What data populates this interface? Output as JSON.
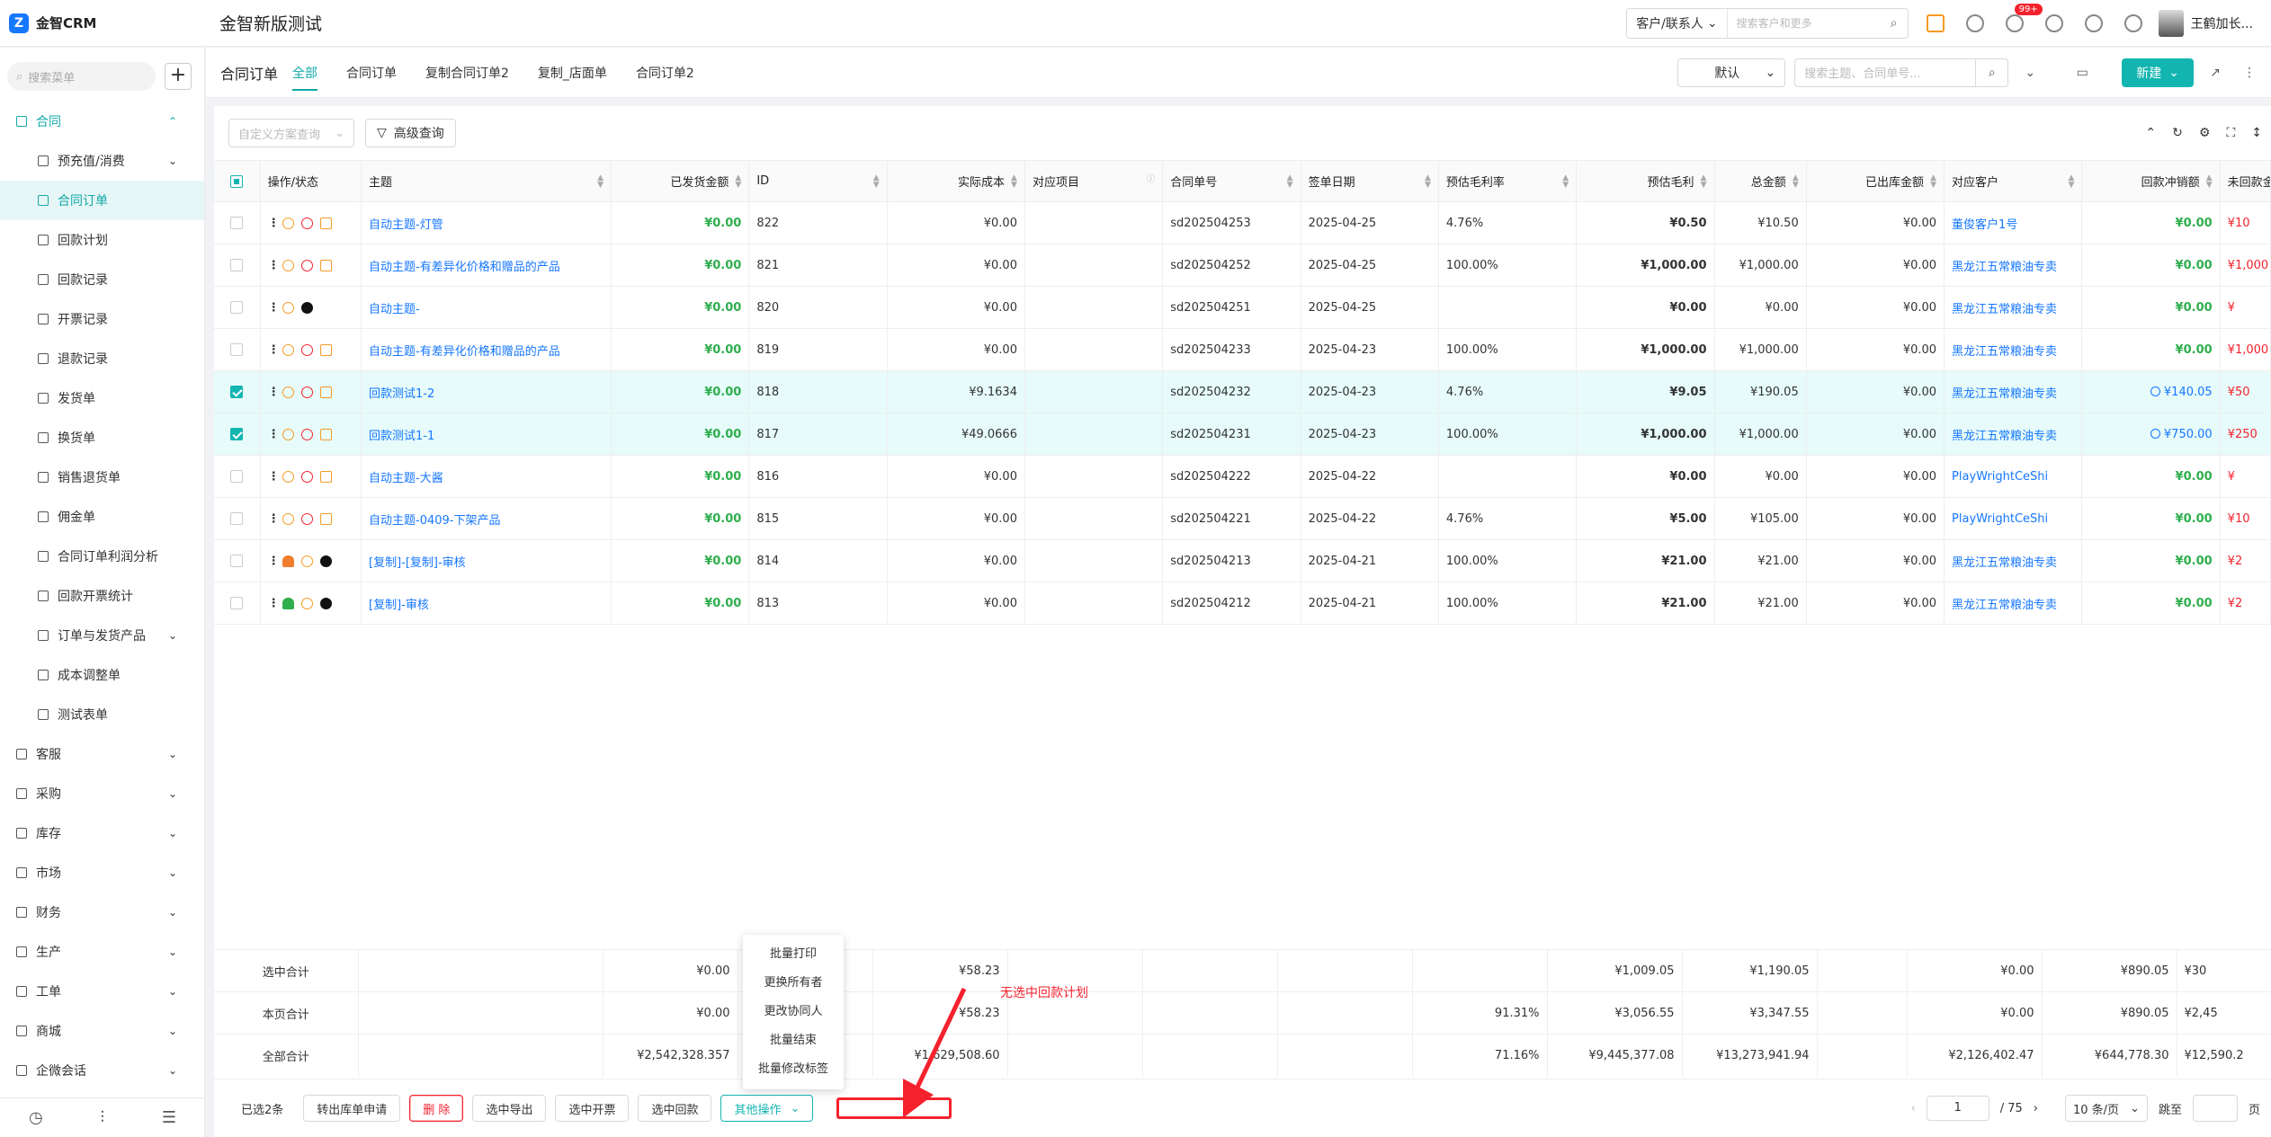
{
  "topbar": {
    "logo": "金智CRM",
    "title": "金智新版测试",
    "search_scope": "客户/联系人",
    "search_placeholder": "搜索客户和更多",
    "notif_badge": "99+",
    "user_name": "王鹤加长..."
  },
  "sidebar": {
    "search_placeholder": "搜索菜单",
    "items": [
      {
        "label": "合同",
        "level": "top",
        "state": "open"
      },
      {
        "label": "预充值/消费",
        "level": "sub",
        "chev": true
      },
      {
        "label": "合同订单",
        "level": "sub",
        "state": "active"
      },
      {
        "label": "回款计划",
        "level": "sub"
      },
      {
        "label": "回款记录",
        "level": "sub"
      },
      {
        "label": "开票记录",
        "level": "sub"
      },
      {
        "label": "退款记录",
        "level": "sub"
      },
      {
        "label": "发货单",
        "level": "sub"
      },
      {
        "label": "换货单",
        "level": "sub"
      },
      {
        "label": "销售退货单",
        "level": "sub"
      },
      {
        "label": "佣金单",
        "level": "sub"
      },
      {
        "label": "合同订单利润分析",
        "level": "sub"
      },
      {
        "label": "回款开票统计",
        "level": "sub"
      },
      {
        "label": "订单与发货产品",
        "level": "sub",
        "chev": true
      },
      {
        "label": "成本调整单",
        "level": "sub"
      },
      {
        "label": "测试表单",
        "level": "sub"
      },
      {
        "label": "客服",
        "level": "top",
        "chev": true
      },
      {
        "label": "采购",
        "level": "top",
        "chev": true
      },
      {
        "label": "库存",
        "level": "top",
        "chev": true
      },
      {
        "label": "市场",
        "level": "top",
        "chev": true
      },
      {
        "label": "财务",
        "level": "top",
        "chev": true
      },
      {
        "label": "生产",
        "level": "top",
        "chev": true
      },
      {
        "label": "工单",
        "level": "top",
        "chev": true
      },
      {
        "label": "商城",
        "level": "top",
        "chev": true
      },
      {
        "label": "企微会话",
        "level": "top",
        "chev": true
      }
    ]
  },
  "header": {
    "page_name": "合同订单",
    "tabs": [
      "全部",
      "合同订单",
      "复制合同订单2",
      "复制_店面单",
      "合同订单2"
    ],
    "view": "默认",
    "keyword_placeholder": "搜索主题、合同单号...",
    "new_label": "新建"
  },
  "filter": {
    "scheme_placeholder": "自定义方案查询",
    "advanced_label": "高级查询"
  },
  "table": {
    "columns": [
      "操作/状态",
      "主题",
      "已发货金额",
      "ID",
      "实际成本",
      "对应项目",
      "合同单号",
      "签单日期",
      "预估毛利率",
      "预估毛利",
      "总金额",
      "已出库金额",
      "对应客户",
      "回款冲销额",
      "未回款金额"
    ],
    "rows": [
      {
        "selected": false,
        "icons": [
          "play",
          "alert",
          "doc"
        ],
        "subject": "自动主题-灯管",
        "shipped": "¥0.00",
        "id": "822",
        "cost": "¥0.00",
        "project": "",
        "no": "sd202504253",
        "date": "2025-04-25",
        "rate": "4.76%",
        "profit": "¥0.50",
        "total": "¥10.50",
        "out": "¥0.00",
        "customer": "董俊客户1号",
        "writeoff": "¥0.00",
        "writeoff_clock": false,
        "unpaid": "¥10"
      },
      {
        "selected": false,
        "icons": [
          "play",
          "alert",
          "doc"
        ],
        "subject": "自动主题-有差异化价格和赠品的产品",
        "shipped": "¥0.00",
        "id": "821",
        "cost": "¥0.00",
        "project": "",
        "no": "sd202504252",
        "date": "2025-04-25",
        "rate": "100.00%",
        "profit": "¥1,000.00",
        "total": "¥1,000.00",
        "out": "¥0.00",
        "customer": "黑龙江五常粮油专卖",
        "writeoff": "¥0.00",
        "writeoff_clock": false,
        "unpaid": "¥1,000"
      },
      {
        "selected": false,
        "icons": [
          "play",
          "x"
        ],
        "subject": "自动主题-",
        "shipped": "¥0.00",
        "id": "820",
        "cost": "¥0.00",
        "project": "",
        "no": "sd202504251",
        "date": "2025-04-25",
        "rate": "",
        "profit": "¥0.00",
        "total": "¥0.00",
        "out": "¥0.00",
        "customer": "黑龙江五常粮油专卖",
        "writeoff": "¥0.00",
        "writeoff_clock": false,
        "unpaid": "¥"
      },
      {
        "selected": false,
        "icons": [
          "play",
          "alert",
          "doc"
        ],
        "subject": "自动主题-有差异化价格和赠品的产品",
        "shipped": "¥0.00",
        "id": "819",
        "cost": "¥0.00",
        "project": "",
        "no": "sd202504233",
        "date": "2025-04-23",
        "rate": "100.00%",
        "profit": "¥1,000.00",
        "total": "¥1,000.00",
        "out": "¥0.00",
        "customer": "黑龙江五常粮油专卖",
        "writeoff": "¥0.00",
        "writeoff_clock": false,
        "unpaid": "¥1,000"
      },
      {
        "selected": true,
        "icons": [
          "play",
          "alert",
          "doc"
        ],
        "subject": "回款测试1-2",
        "shipped": "¥0.00",
        "id": "818",
        "cost": "¥9.1634",
        "project": "",
        "no": "sd202504232",
        "date": "2025-04-23",
        "rate": "4.76%",
        "profit": "¥9.05",
        "total": "¥190.05",
        "out": "¥0.00",
        "customer": "黑龙江五常粮油专卖",
        "writeoff": "¥140.05",
        "writeoff_clock": true,
        "unpaid": "¥50"
      },
      {
        "selected": true,
        "icons": [
          "play",
          "alert",
          "doc"
        ],
        "subject": "回款测试1-1",
        "shipped": "¥0.00",
        "id": "817",
        "cost": "¥49.0666",
        "project": "",
        "no": "sd202504231",
        "date": "2025-04-23",
        "rate": "100.00%",
        "profit": "¥1,000.00",
        "total": "¥1,000.00",
        "out": "¥0.00",
        "customer": "黑龙江五常粮油专卖",
        "writeoff": "¥750.00",
        "writeoff_clock": true,
        "unpaid": "¥250"
      },
      {
        "selected": false,
        "icons": [
          "play",
          "alert",
          "doc"
        ],
        "subject": "自动主题-大酱",
        "shipped": "¥0.00",
        "id": "816",
        "cost": "¥0.00",
        "project": "",
        "no": "sd202504222",
        "date": "2025-04-22",
        "rate": "",
        "profit": "¥0.00",
        "total": "¥0.00",
        "out": "¥0.00",
        "customer": "PlayWrightCeShi",
        "writeoff": "¥0.00",
        "writeoff_clock": false,
        "unpaid": "¥"
      },
      {
        "selected": false,
        "icons": [
          "play",
          "alert",
          "doc"
        ],
        "subject": "自动主题-0409-下架产品",
        "shipped": "¥0.00",
        "id": "815",
        "cost": "¥0.00",
        "project": "",
        "no": "sd202504221",
        "date": "2025-04-22",
        "rate": "4.76%",
        "profit": "¥5.00",
        "total": "¥105.00",
        "out": "¥0.00",
        "customer": "PlayWrightCeShi",
        "writeoff": "¥0.00",
        "writeoff_clock": false,
        "unpaid": "¥10"
      },
      {
        "selected": false,
        "icons": [
          "person",
          "play",
          "x"
        ],
        "subject": "[复制]-[复制]-审核",
        "shipped": "¥0.00",
        "id": "814",
        "cost": "¥0.00",
        "project": "",
        "no": "sd202504213",
        "date": "2025-04-21",
        "rate": "100.00%",
        "profit": "¥21.00",
        "total": "¥21.00",
        "out": "¥0.00",
        "customer": "黑龙江五常粮油专卖",
        "writeoff": "¥0.00",
        "writeoff_clock": false,
        "unpaid": "¥2"
      },
      {
        "selected": false,
        "icons": [
          "person-green",
          "play",
          "x"
        ],
        "subject": "[复制]-审核",
        "shipped": "¥0.00",
        "id": "813",
        "cost": "¥0.00",
        "project": "",
        "no": "sd202504212",
        "date": "2025-04-21",
        "rate": "100.00%",
        "profit": "¥21.00",
        "total": "¥21.00",
        "out": "¥0.00",
        "customer": "黑龙江五常粮油专卖",
        "writeoff": "¥0.00",
        "writeoff_clock": false,
        "unpaid": "¥2"
      }
    ]
  },
  "summary": [
    {
      "label": "选中合计",
      "shipped": "¥0.00",
      "cost": "¥58.23",
      "rate": "",
      "profit": "¥1,009.05",
      "total": "¥1,190.05",
      "out": "¥0.00",
      "writeoff": "¥890.05",
      "unpaid": "¥30"
    },
    {
      "label": "本页合计",
      "shipped": "¥0.00",
      "cost": "¥58.23",
      "rate": "91.31%",
      "profit": "¥3,056.55",
      "total": "¥3,347.55",
      "out": "¥0.00",
      "writeoff": "¥890.05",
      "unpaid": "¥2,45"
    },
    {
      "label": "全部合计",
      "shipped": "¥2,542,328.357",
      "cost": "¥1,629,508.60",
      "rate": "71.16%",
      "profit": "¥9,445,377.08",
      "total": "¥13,273,941.94",
      "out": "¥2,126,402.47",
      "writeoff": "¥644,778.30",
      "unpaid": "¥12,590.2"
    }
  ],
  "bottom": {
    "selected_count": "已选2条",
    "buttons": [
      "转出库单申请",
      "删 除",
      "选中导出",
      "选中开票",
      "选中回款"
    ],
    "more_label": "其他操作",
    "dropdown": [
      "批量打印",
      "更换所有者",
      "更改协同人",
      "批量结束",
      "批量修改标签"
    ],
    "page": "1",
    "total_pages": "/ 75",
    "page_size": "10 条/页",
    "jump_label": "跳至",
    "page_unit": "页"
  },
  "annotation": "无选中回款计划",
  "colors": {
    "accent": "#13b5b1",
    "danger": "#f5222d",
    "link": "#1677ff",
    "money_green": "#2fae4d"
  }
}
